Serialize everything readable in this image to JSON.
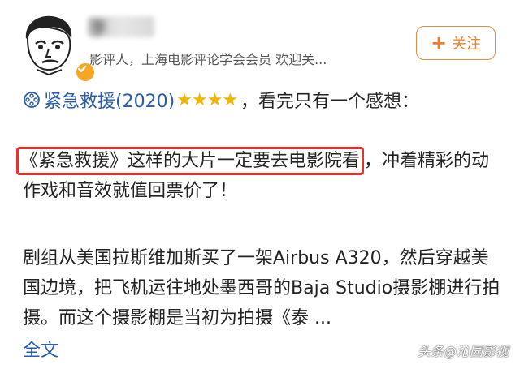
{
  "header": {
    "username": "李",
    "bio": "影评人，上海电影评论学会会员 欢迎关...",
    "follow_label": "关注",
    "follow_plus": "+"
  },
  "movie": {
    "title": "紧急救援(2020)",
    "stars": "★★★★",
    "rating": 4,
    "comment": "，看完只有一个感想："
  },
  "paragraph1": {
    "highlighted": "《紧急救援》这样的大片一定要去电影院看",
    "rest": "，冲着精彩的动作戏和音效就值回票价了！"
  },
  "paragraph2": {
    "text": "剧组从美国拉斯维加斯买了一架Airbus A320，然后穿越美国边境，把飞机运往地处墨西哥的Baja Studio摄影棚进行拍摄。而这个摄影棚是当初为拍摄《泰 ..."
  },
  "expand_label": "全文",
  "watermark": "头条@沁园影视",
  "colors": {
    "accent_orange": "#f07d2a",
    "link_blue": "#2a5ca8",
    "highlight_red": "#e8312a",
    "star_gold": "#f5b400",
    "verified_badge": "#f5a623"
  },
  "icons": {
    "avatar": "cartoon-face-avatar",
    "verified": "verified-badge-icon",
    "film": "film-reel-icon"
  }
}
